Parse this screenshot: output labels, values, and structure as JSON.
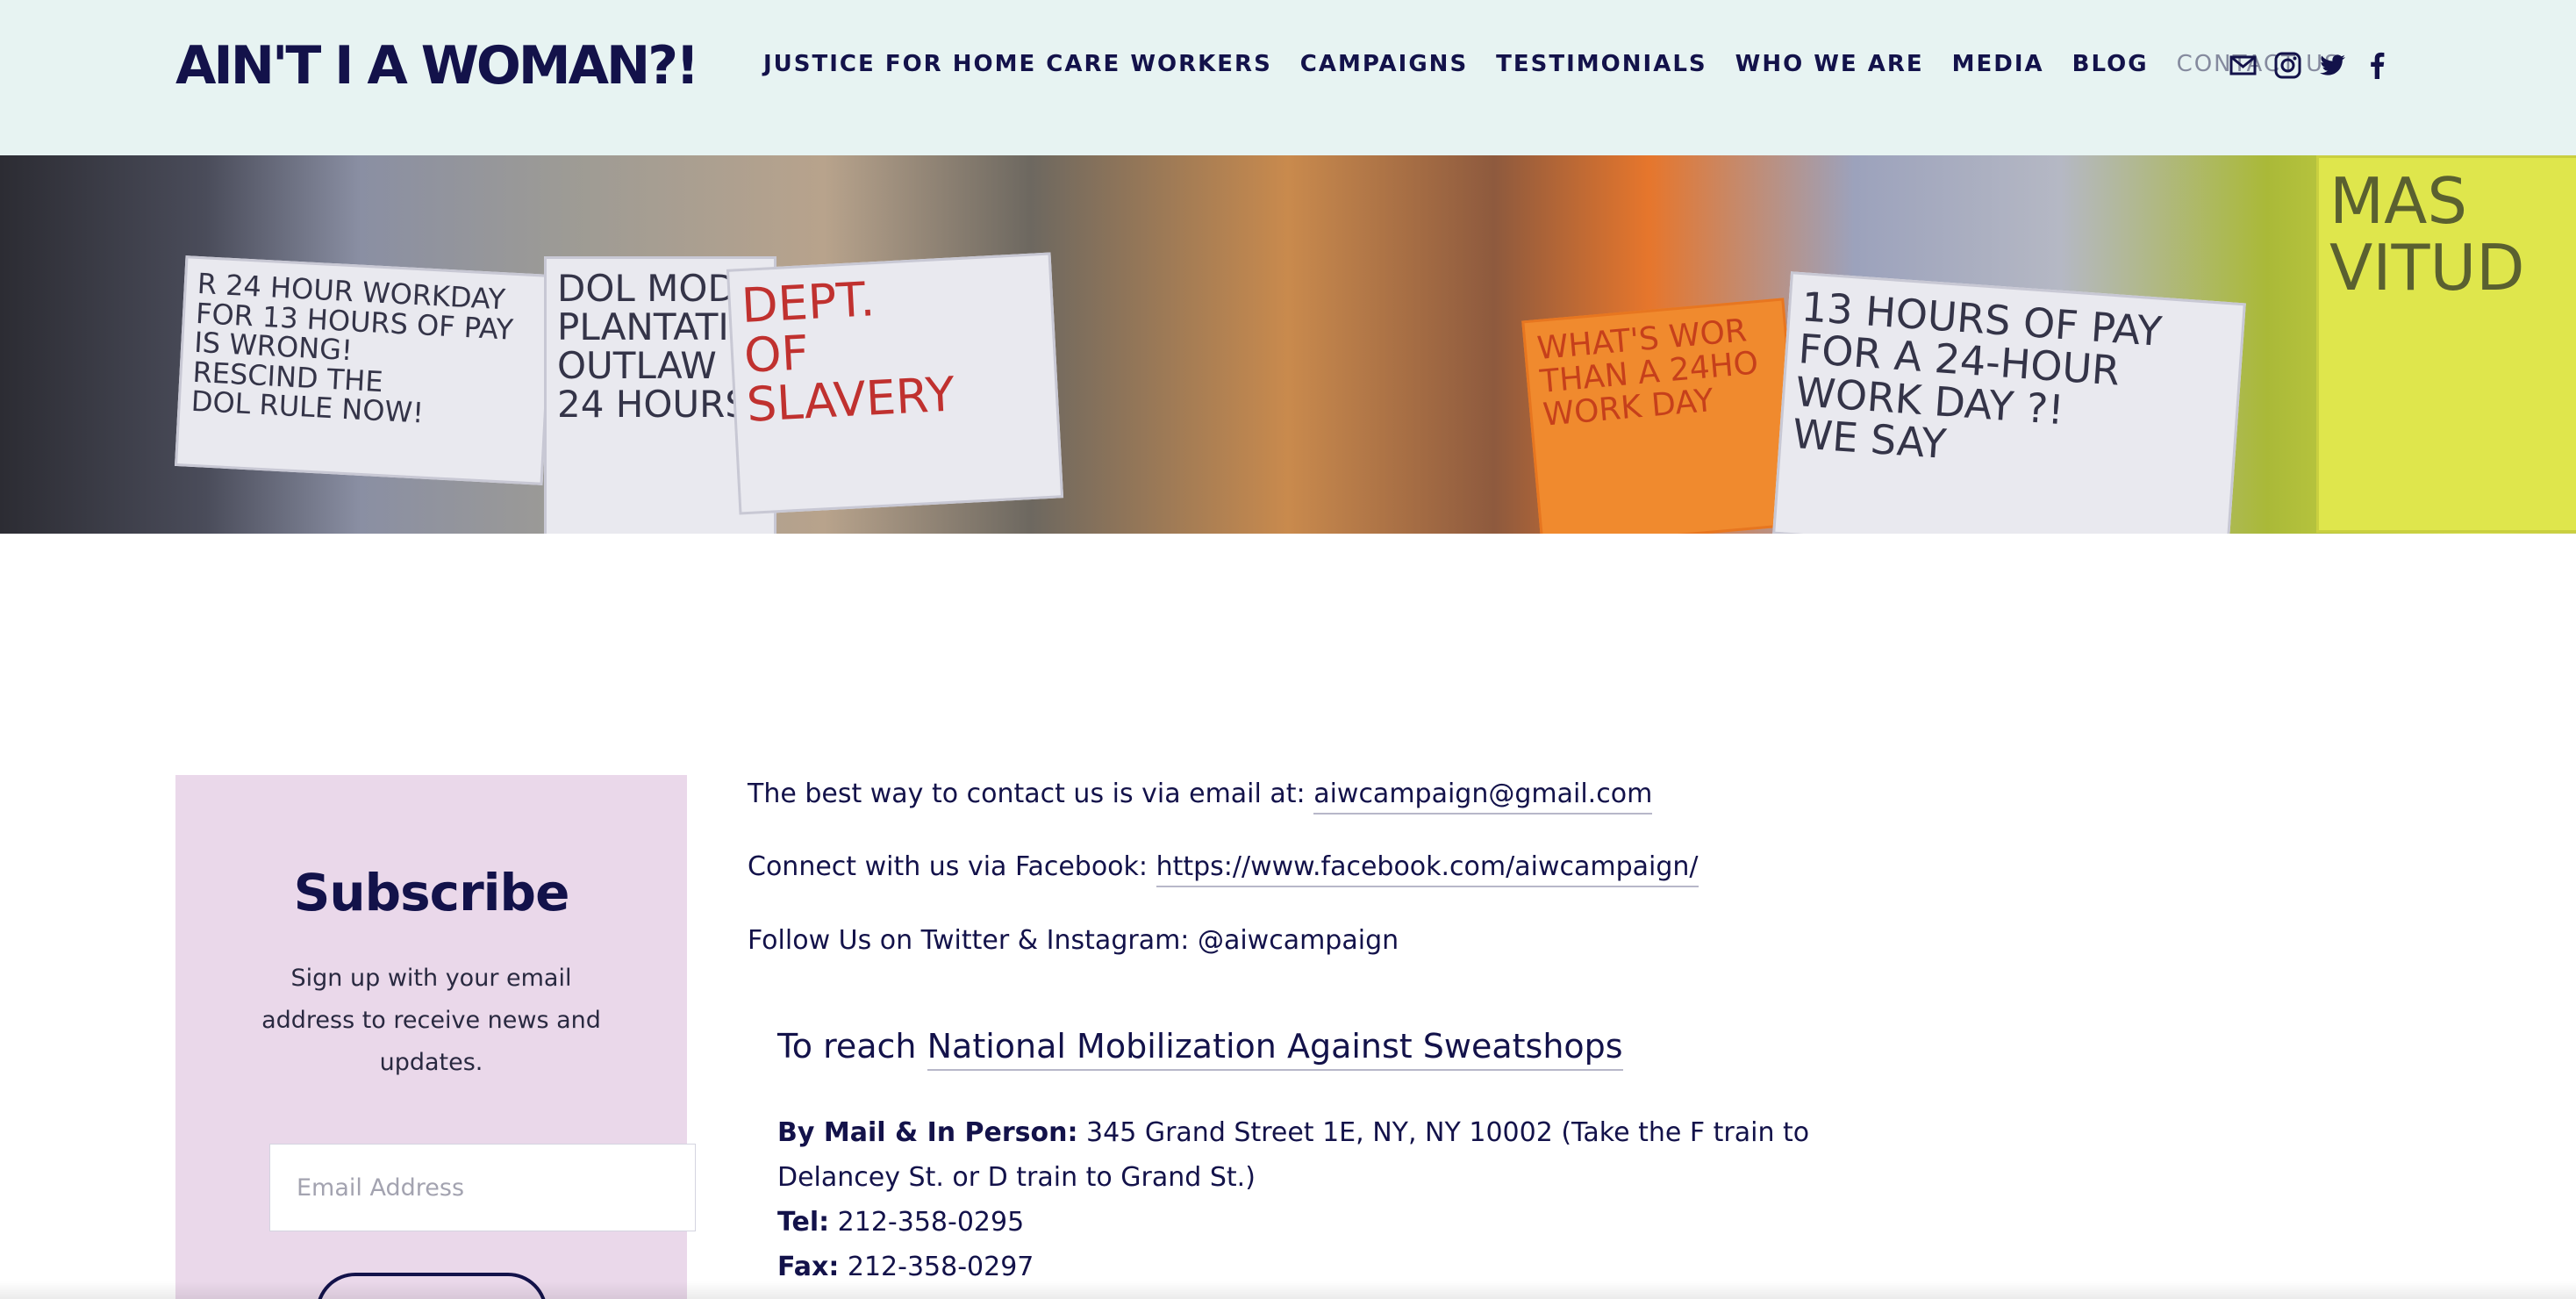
{
  "site": {
    "logo": "AIN'T I A WOMAN?!"
  },
  "nav": {
    "items": [
      "JUSTICE FOR HOME CARE WORKERS",
      "CAMPAIGNS",
      "TESTIMONIALS",
      "WHO WE ARE",
      "MEDIA",
      "BLOG",
      "CONTACT US"
    ],
    "active": "CONTACT US",
    "social_icons": [
      "mail-icon",
      "instagram-icon",
      "twitter-icon",
      "facebook-icon"
    ]
  },
  "hero": {
    "signs": [
      "R 24 HOUR WORKDAY\nFOR 13 HOURS OF PAY\nIS WRONG!\nRESCIND THE\nDOL RULE NOW!",
      "DOL MOD\nPLANTATIO\nOUTLAW\n24 HOURS!",
      "DEPT.\nOF\nSLAVERY",
      "WHAT'S WOR\nTHAN A 24HO\nWORK DAY",
      "13 HOURS OF PAY\nFOR A 24-HOUR\nWORK DAY ?!\nWE SAY",
      "MAS\nVITUD"
    ]
  },
  "subscribe": {
    "title": "Subscribe",
    "text": "Sign up with your email address to receive news and updates.",
    "email_placeholder": "Email Address"
  },
  "contact": {
    "email_prefix": "The best way to contact us is via email at:",
    "email": "aiwcampaign@gmail.com",
    "facebook_prefix": "Connect with us via Facebook:",
    "facebook_url": "https://www.facebook.com/aiwcampaign/",
    "twitter_line": "Follow Us on Twitter & Instagram: @aiwcampaign",
    "reach_prefix": "To reach",
    "org_link": "National Mobilization Against Sweatshops",
    "mail_label": "By Mail & In Person:",
    "mail_value": "345 Grand Street 1E, NY, NY 10002  (Take the F train to Delancey St. or D train to Grand St.)",
    "tel_label": "Tel:",
    "tel_value": "212-358-0295",
    "fax_label": "Fax:",
    "fax_value": "212-358-0297"
  },
  "colors": {
    "header_bg": "#e7f3f2",
    "navy": "#13124a",
    "nav_active": "#858a9e",
    "subscribe_bg": "#ead8ea"
  }
}
